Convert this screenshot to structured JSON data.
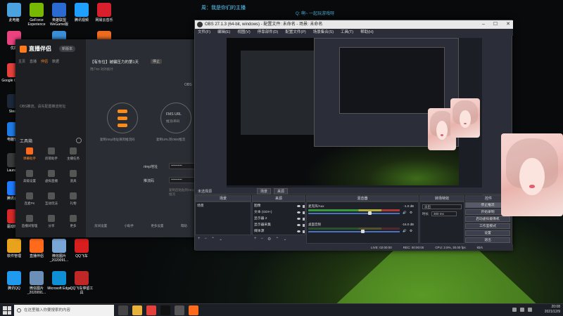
{
  "desktop": {
    "icons": [
      {
        "label": "此电脑",
        "color": "#4aa3df"
      },
      {
        "label": "GeForce Experience",
        "color": "#76b900"
      },
      {
        "label": "英雄联盟 WeGame版",
        "color": "#2b6bd1"
      },
      {
        "label": "腾讯视频",
        "color": "#1fa0ff"
      },
      {
        "label": "网易云音乐",
        "color": "#d8202c"
      },
      {
        "label": "优酷",
        "color": "#e9427e"
      },
      {
        "label": "",
        "color": "#3a8fd8"
      },
      {
        "label": "",
        "color": "#ee6a1f"
      },
      {
        "label": "Google Chrome",
        "color": "#e6403b"
      },
      {
        "label": "Steam",
        "color": "#1b2838"
      },
      {
        "label": "电脑管家",
        "color": "#1e7be6"
      },
      {
        "label": "Launcher",
        "color": "#3a3a3a"
      },
      {
        "label": "腾讯会议",
        "color": "#1f7bff"
      },
      {
        "label": "驱动精灵",
        "color": "#d82828"
      },
      {
        "label": "软件管理",
        "color": "#e8a21c"
      },
      {
        "label": "直播伴侣",
        "color": "#ff6b1a"
      },
      {
        "label": "微信图片_2020091...",
        "color": "#7aa6d6"
      },
      {
        "label": "QQ飞车",
        "color": "#d81e1e"
      },
      {
        "label": "腾讯QQ",
        "color": "#1f9aef"
      },
      {
        "label": "微信图片_2020091...",
        "color": "#6c8fb8"
      },
      {
        "label": "Microsoft Edge",
        "color": "#0f8fd6"
      },
      {
        "label": "QQ飞车停留工具",
        "color": "#c02727"
      }
    ]
  },
  "overlay": {
    "line1": "周：我是你们的主播",
    "line2": "Q: 啊~ 一起玩游戏呀"
  },
  "live_app": {
    "logo": "直播伴侣",
    "version": "新版本",
    "tabs": [
      "主页",
      "直播",
      "伴侣",
      "数据"
    ],
    "active_tab": "伴侣",
    "empty_text": "OBS推流，请先配置推流地址",
    "tools_title": "工具箱",
    "tools": [
      "弹幕助手",
      "房管助手",
      "主播任务",
      "高级设置",
      "虚拟直播",
      "道具",
      "连麦PK",
      "互动玩法",
      "礼物",
      "直播间管理",
      "分享",
      "更多"
    ],
    "stream_title": "【有车位】被骗压力的第1天",
    "stream_badge": "停止",
    "stream_sub": "用户ID  对外统计",
    "obs_label": "OBS",
    "flow_left": "复制rtmp地址填到推流码",
    "flow_right_title": "FMS URL",
    "flow_right_sub": "推流/串码",
    "flow_right_caption": "复制URL到OBS推流",
    "rtmp_label": "rtmp地址",
    "stream_key_label": "推流码",
    "rtmp_hint": "复制后粘贴到rtmp推流",
    "footer": [
      "房间设置",
      "小助手",
      "更多设置",
      "帮助"
    ]
  },
  "obs": {
    "title": "OBS 27.1.3 (64-bit, windows) - 配置文件: 未命名 - 场景: 未命名",
    "menu": [
      "文件(F)",
      "编辑(E)",
      "视图(V)",
      "停靠部件(D)",
      "配置文件(P)",
      "场景集合(S)",
      "工具(T)",
      "帮助(H)"
    ],
    "scene_filter": "场景",
    "scene_filter2": "来源",
    "no_source": "未选择源",
    "docks": {
      "scenes": "场景",
      "sources": "来源",
      "mixer": "混音器",
      "transitions": "转场特效",
      "controls": "控件"
    },
    "scenes": [
      "场景"
    ],
    "sources": [
      "图像",
      "文本 (GDI+)",
      "显示器 2",
      "显示器采集",
      "媒体源"
    ],
    "mixer": [
      {
        "name": "麦克风/Aux",
        "db": "-1.0 dB",
        "level": 0.65
      },
      {
        "name": "桌面音频",
        "db": "-16.0 dB",
        "level": 0.58
      }
    ],
    "transition": {
      "type": "淡出",
      "duration_label": "时长",
      "duration": "300 ms"
    },
    "controls": [
      "停止推流",
      "开始录制",
      "启动虚拟摄像机",
      "工作室模式",
      "设置",
      "退出"
    ],
    "status": [
      "LIVE: 02:00:00",
      "REC: 00:00:00",
      "CPU: 2.5%, 30.00 fps",
      "kb/s"
    ]
  },
  "taskbar": {
    "search_placeholder": "在这里输入你要搜索的内容",
    "time": "20:08",
    "date": "2021/12/9",
    "apps": [
      {
        "name": "task-view",
        "color": "#444"
      },
      {
        "name": "file-explorer",
        "color": "#e8b13a"
      },
      {
        "name": "chrome",
        "color": "#e6403b"
      },
      {
        "name": "douyin",
        "color": "#111"
      },
      {
        "name": "obs",
        "color": "#555"
      },
      {
        "name": "live-companion",
        "color": "#ff6b1a"
      }
    ]
  }
}
